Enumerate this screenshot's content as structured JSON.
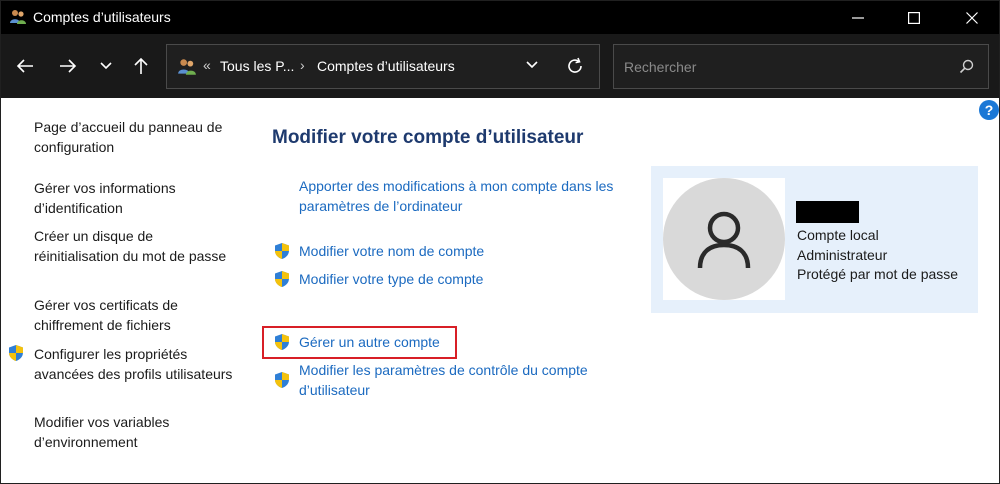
{
  "window": {
    "title": "Comptes d’utilisateurs"
  },
  "address": {
    "overflow": "«",
    "crumb1": "Tous les P...",
    "sep": "›",
    "crumb2": "Comptes d’utilisateurs"
  },
  "search": {
    "placeholder": "Rechercher"
  },
  "help": "?",
  "sidebar": {
    "items": [
      {
        "label": "Page d’accueil du panneau de configuration"
      },
      {
        "label": "Gérer vos informations d’identification"
      },
      {
        "label": "Créer un disque de réinitialisation du mot de passe"
      },
      {
        "label": "Gérer vos certificats de chiffrement de fichiers"
      },
      {
        "label": "Configurer les propriétés avancées des profils utilisateurs"
      },
      {
        "label": "Modifier vos variables d’environnement"
      }
    ]
  },
  "main": {
    "title": "Modifier votre compte d’utilisateur",
    "links": [
      {
        "label": "Apporter des modifications à mon compte dans les paramètres de l’ordinateur"
      },
      {
        "label": "Modifier votre nom de compte"
      },
      {
        "label": "Modifier votre type de compte"
      },
      {
        "label": "Gérer un autre compte"
      },
      {
        "label": "Modifier les paramètres de contrôle du compte d’utilisateur"
      }
    ]
  },
  "user": {
    "type": "Compte local",
    "role": "Administrateur",
    "protection": "Protégé par mot de passe"
  },
  "colors": {
    "link": "#1b6ac0",
    "heading": "#1e3a6e",
    "highlight_border": "#d81f26",
    "card_bg": "#e6f0fb"
  }
}
